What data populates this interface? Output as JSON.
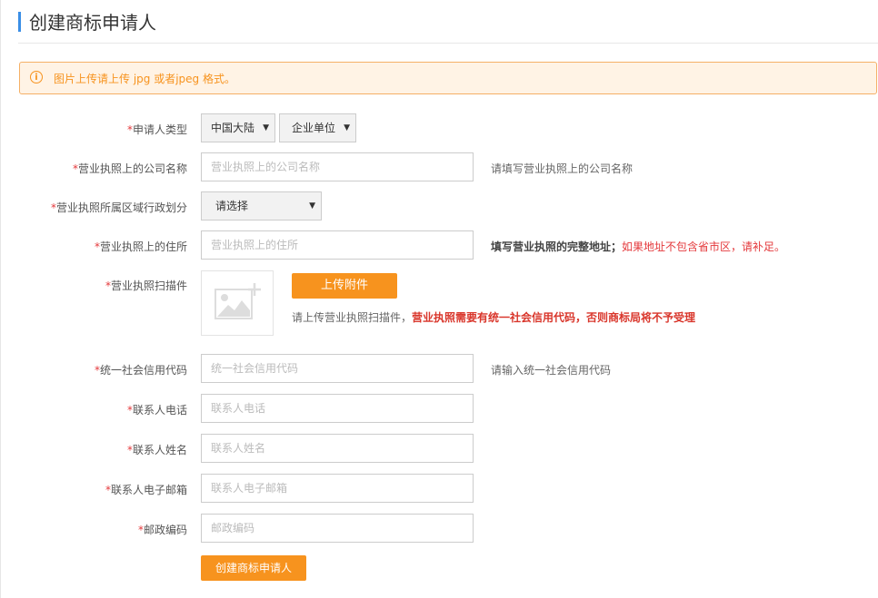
{
  "page": {
    "title": "创建商标申请人"
  },
  "notice": {
    "text": "图片上传请上传 jpg 或者jpeg 格式。",
    "icon": "info-icon"
  },
  "form": {
    "required_mark": "*",
    "applicant_type": {
      "label": "申请人类型",
      "region": "中国大陆",
      "entity": "企业单位"
    },
    "company_name": {
      "label": "营业执照上的公司名称",
      "placeholder": "营业执照上的公司名称",
      "hint": "请填写营业执照上的公司名称"
    },
    "admin_region": {
      "label": "营业执照所属区域行政划分",
      "value": "请选择"
    },
    "address": {
      "label": "营业执照上的住所",
      "placeholder": "营业执照上的住所",
      "hint_bold": "填写营业执照的完整地址；",
      "hint_red": "如果地址不包含省市区，请补足。"
    },
    "license_scan": {
      "label": "营业执照扫描件",
      "upload_button": "上传附件",
      "hint_prefix": "请上传营业执照扫描件，",
      "hint_red": "营业执照需要有统一社会信用代码，否则商标局将不予受理",
      "placeholder_icon": "image-add-icon"
    },
    "credit_code": {
      "label": "统一社会信用代码",
      "placeholder": "统一社会信用代码",
      "hint": "请输入统一社会信用代码"
    },
    "contact_phone": {
      "label": "联系人电话",
      "placeholder": "联系人电话"
    },
    "contact_name": {
      "label": "联系人姓名",
      "placeholder": "联系人姓名"
    },
    "contact_email": {
      "label": "联系人电子邮箱",
      "placeholder": "联系人电子邮箱"
    },
    "postal_code": {
      "label": "邮政编码",
      "placeholder": "邮政编码"
    },
    "submit_label": "创建商标申请人"
  },
  "colors": {
    "accent": "#f7931e",
    "required": "#e4393c",
    "title_bar": "#3a8ee6"
  }
}
